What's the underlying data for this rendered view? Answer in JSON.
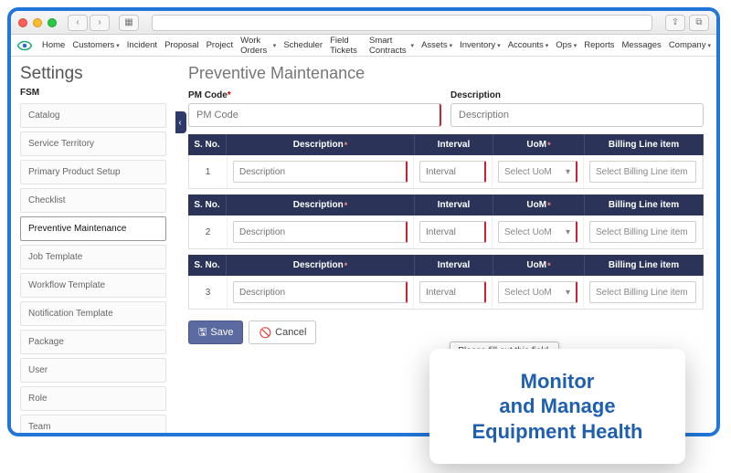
{
  "nav": [
    "Home",
    "Customers",
    "Incident",
    "Proposal",
    "Project",
    "Work Orders",
    "Scheduler",
    "Field Tickets",
    "Smart Contracts",
    "Assets",
    "Inventory",
    "Accounts",
    "Ops",
    "Reports",
    "Messages",
    "Company"
  ],
  "nav_has_caret": [
    false,
    true,
    false,
    false,
    false,
    true,
    false,
    false,
    true,
    true,
    true,
    true,
    true,
    false,
    false,
    true
  ],
  "sidebar": {
    "title": "Settings",
    "section": "FSM",
    "items": [
      "Catalog",
      "Service Territory",
      "Primary Product Setup",
      "Checklist",
      "Preventive Maintenance",
      "Job Template",
      "Workflow Template",
      "Notification Template",
      "Package",
      "User",
      "Role",
      "Team"
    ],
    "active_index": 4
  },
  "page": {
    "title": "Preventive Maintenance",
    "pm_label": "PM Code",
    "pm_placeholder": "PM Code",
    "desc_label": "Description",
    "desc_placeholder": "Description"
  },
  "grid": {
    "headers": {
      "sno": "S. No.",
      "desc": "Description",
      "interval": "Interval",
      "uom": "UoM",
      "bill": "Billing Line item"
    },
    "rows": [
      {
        "no": "1",
        "desc_ph": "Description",
        "int_ph": "Interval",
        "uom_ph": "Select UoM",
        "bill_ph": "Select Billing Line item"
      },
      {
        "no": "2",
        "desc_ph": "Description",
        "int_ph": "Interval",
        "uom_ph": "Select UoM",
        "bill_ph": "Select Billing Line item"
      },
      {
        "no": "3",
        "desc_ph": "Description",
        "int_ph": "Interval",
        "uom_ph": "Select UoM",
        "bill_ph": "Select Billing Line item"
      }
    ]
  },
  "buttons": {
    "save": "Save",
    "cancel": "Cancel"
  },
  "tooltip": "Please fill out this field.",
  "callout": {
    "line1": "Monitor",
    "line2": "and Manage",
    "line3": "Equipment Health"
  }
}
